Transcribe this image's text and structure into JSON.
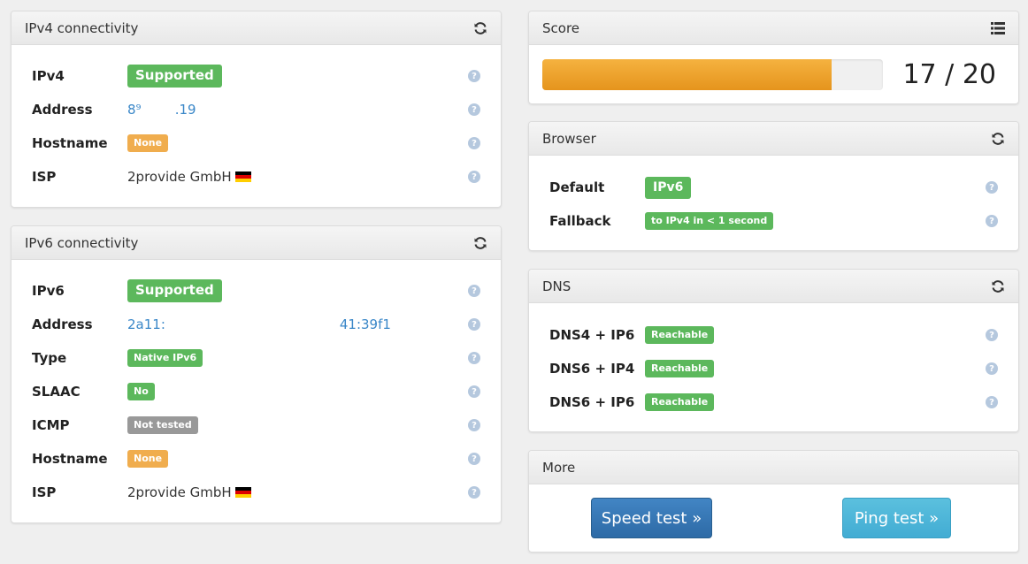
{
  "ipv4": {
    "title": "IPv4 connectivity",
    "rows": [
      {
        "label": "IPv4",
        "value": "Supported"
      },
      {
        "label": "Address",
        "value": "8⁹        .19"
      },
      {
        "label": "Hostname",
        "value": "None"
      },
      {
        "label": "ISP",
        "value": "2provide GmbH"
      }
    ]
  },
  "ipv6": {
    "title": "IPv6 connectivity",
    "rows": [
      {
        "label": "IPv6",
        "value": "Supported"
      },
      {
        "label": "Address",
        "value": "2a11:                                          41:39f1"
      },
      {
        "label": "Type",
        "value": "Native IPv6"
      },
      {
        "label": "SLAAC",
        "value": "No"
      },
      {
        "label": "ICMP",
        "value": "Not tested"
      },
      {
        "label": "Hostname",
        "value": "None"
      },
      {
        "label": "ISP",
        "value": "2provide GmbH"
      }
    ]
  },
  "score": {
    "title": "Score",
    "text": "17 / 20",
    "fraction": 0.85
  },
  "browser": {
    "title": "Browser",
    "rows": [
      {
        "label": "Default",
        "value": "IPv6"
      },
      {
        "label": "Fallback",
        "value": "to IPv4 in < 1 second"
      }
    ]
  },
  "dns": {
    "title": "DNS",
    "rows": [
      {
        "label": "DNS4 + IP6",
        "value": "Reachable"
      },
      {
        "label": "DNS6 + IP4",
        "value": "Reachable"
      },
      {
        "label": "DNS6 + IP6",
        "value": "Reachable"
      }
    ]
  },
  "more": {
    "title": "More",
    "speed_test": "Speed test »",
    "ping_test": "Ping test »"
  },
  "help_glyph": "?",
  "colors": {
    "success": "#5cb85c",
    "warning": "#f0ad4e",
    "default": "#999999",
    "link": "#3a87c8",
    "primary": "#2d6aa6",
    "info": "#5bc0de",
    "score_bar": "#e5941d"
  },
  "icons": {
    "refresh": "refresh-icon",
    "list": "list-icon",
    "help": "help-icon",
    "flag": "flag-de-icon"
  }
}
